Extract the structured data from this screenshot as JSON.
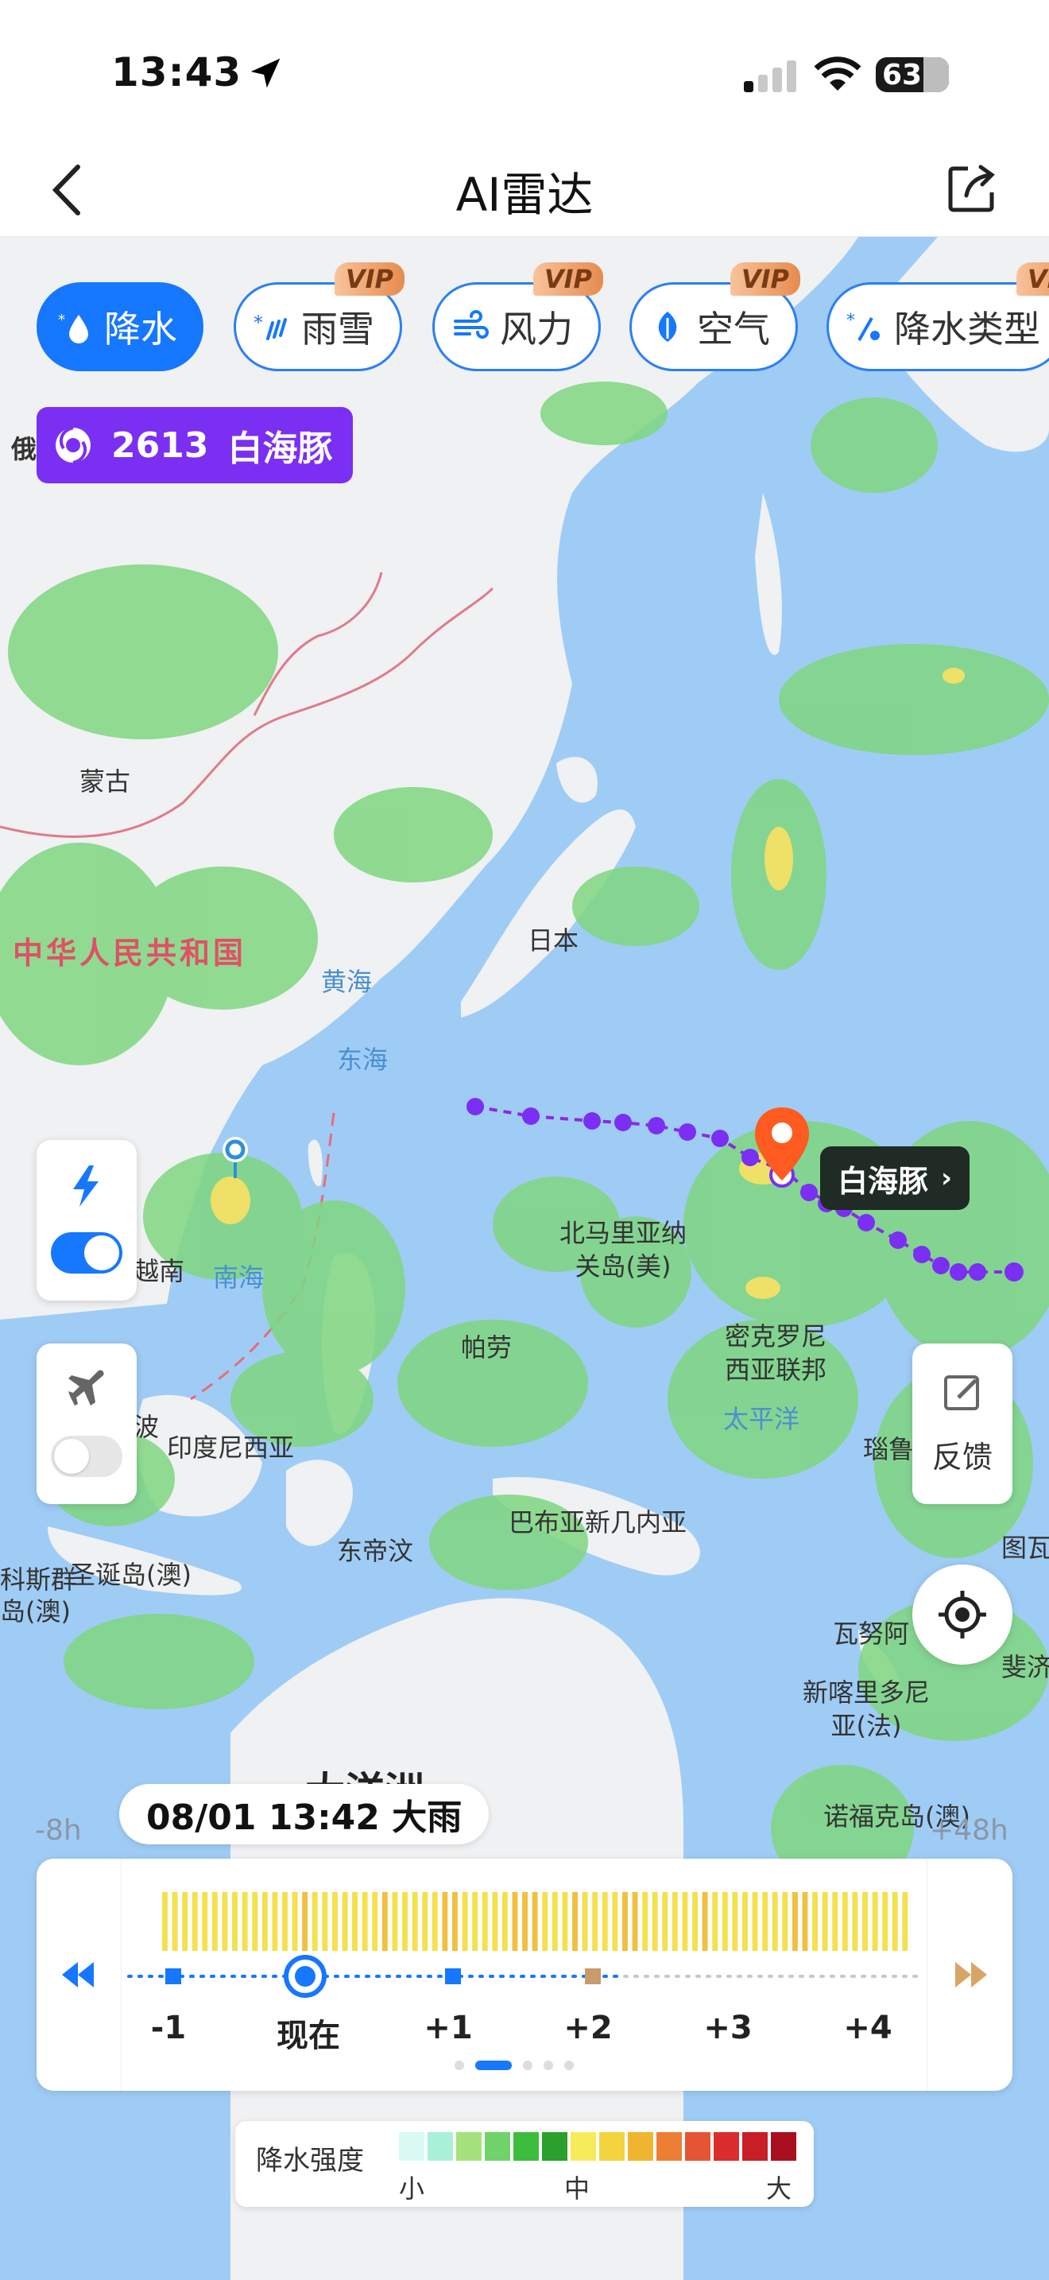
{
  "status_bar": {
    "time": "13:43",
    "battery": "63"
  },
  "header": {
    "title": "AI雷达"
  },
  "layers": [
    {
      "label": "降水",
      "active": true,
      "vip": false,
      "icon": "rain-drop-icon"
    },
    {
      "label": "雨雪",
      "active": false,
      "vip": true,
      "icon": "snow-rain-icon"
    },
    {
      "label": "风力",
      "active": false,
      "vip": true,
      "icon": "wind-icon"
    },
    {
      "label": "空气",
      "active": false,
      "vip": true,
      "icon": "leaf-icon"
    },
    {
      "label": "降水类型",
      "active": false,
      "vip": true,
      "icon": "precip-type-icon"
    }
  ],
  "vip_label": "VIP",
  "typhoon": {
    "code": "2613",
    "name": "白海豚"
  },
  "map_labels": {
    "russia": "俄",
    "mongolia": "蒙古",
    "china": "中华人民共和国",
    "yellow_sea": "黄海",
    "east_sea": "东海",
    "japan": "日本",
    "vietnam": "越南",
    "south_sea": "南海",
    "n_mariana": "北马里亚纳\n关岛(美)",
    "palau": "帕劳",
    "micronesia": "密克罗尼\n西亚联邦",
    "pacific": "太平洋",
    "philippines_frag": "波",
    "indonesia": "印度尼西亚",
    "timor": "东帝汶",
    "png": "巴布亚新几内亚",
    "cocos": "科斯群",
    "christmas": "圣诞岛(澳)",
    "cocos2": "岛(澳)",
    "tuvalu_frag": "图瓦",
    "solomon": "瑙鲁",
    "vanuatu": "瓦努阿",
    "fiji": "斐济",
    "new_caledonia": "新喀里多尼\n亚(法)",
    "norfolk": "诺福克岛(澳)",
    "oceania": "大洋洲"
  },
  "storm_label": "白海豚",
  "controls": {
    "feedback": "反馈",
    "lightning_on": true,
    "flight_on": false
  },
  "timeline": {
    "current": "08/01 13:42  大雨",
    "left_hint": "-8h",
    "right_hint": "+48h",
    "ticks": [
      "-1",
      "现在",
      "+1",
      "+2",
      "+3",
      "+4"
    ],
    "bar_levels": [
      1,
      1,
      1,
      1,
      1,
      1,
      1,
      1,
      1,
      1,
      1,
      1,
      1,
      1,
      2,
      1,
      1,
      1,
      1,
      1,
      1,
      1,
      2,
      1,
      1,
      1,
      1,
      1,
      2,
      2,
      1,
      1,
      1,
      1,
      1,
      2,
      2,
      2,
      1,
      1,
      1,
      2,
      1,
      1,
      1,
      1,
      2,
      2,
      1,
      1,
      1,
      1,
      1,
      1,
      2,
      1,
      1,
      1,
      1,
      1,
      1,
      1,
      1,
      2,
      2,
      1,
      1,
      1,
      1,
      1,
      1,
      1,
      1,
      1,
      1
    ]
  },
  "legend": {
    "title": "降水强度",
    "small": "小",
    "medium": "中",
    "large": "大",
    "colors": [
      "#d9fbf4",
      "#a9f0d8",
      "#a5e27b",
      "#6fd36a",
      "#3dbd3d",
      "#2ca02c",
      "#f6ec5a",
      "#f3d43c",
      "#f0b530",
      "#ee7e33",
      "#e65533",
      "#db2d2d",
      "#c81e28",
      "#a8101f"
    ]
  },
  "colors": {
    "accent": "#1677ff",
    "typhoon": "#7b2ff2",
    "pin": "#ff5a1f",
    "sea": "#9fccf5",
    "land": "#eff1f3"
  }
}
